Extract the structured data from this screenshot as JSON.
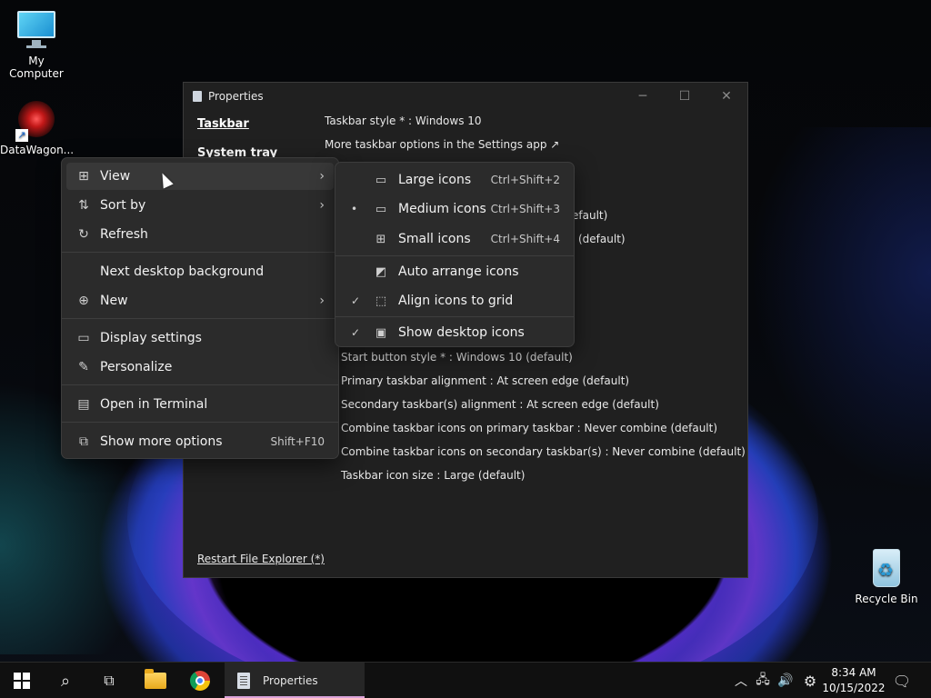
{
  "desktop": {
    "icons": [
      {
        "label": "My Computer",
        "icon": "computer-icon"
      },
      {
        "label": "DataWagon...",
        "icon": "app-shortcut-icon"
      },
      {
        "label": "Recycle Bin",
        "icon": "recycle-bin-icon"
      }
    ]
  },
  "window": {
    "title": "Properties",
    "nav": [
      "Taskbar",
      "System tray"
    ],
    "settings_top": [
      "Taskbar style * : Windows 10",
      "More taskbar options in the Settings app ↗"
    ],
    "partial_fragments": [
      "efault)",
      "(default)"
    ],
    "settings": [
      "Start button style * : Windows 10 (default)",
      "Primary taskbar alignment : At screen edge (default)",
      "Secondary taskbar(s) alignment : At screen edge (default)",
      "Combine taskbar icons on primary taskbar : Never combine (default)",
      "Combine taskbar icons on secondary taskbar(s) : Never combine (default)",
      "Taskbar icon size : Large (default)"
    ],
    "restart_link": "Restart File Explorer (*)"
  },
  "context_menu": {
    "items": [
      {
        "label": "View",
        "icon": "grid-icon",
        "submenu": true
      },
      {
        "label": "Sort by",
        "icon": "sort-icon",
        "submenu": true
      },
      {
        "label": "Refresh",
        "icon": "refresh-icon"
      },
      {
        "label": "Next desktop background",
        "icon": ""
      },
      {
        "label": "New",
        "icon": "plus-circle-icon",
        "submenu": true
      },
      {
        "label": "Display settings",
        "icon": "display-icon"
      },
      {
        "label": "Personalize",
        "icon": "brush-icon"
      },
      {
        "label": "Open in Terminal",
        "icon": "terminal-icon"
      },
      {
        "label": "Show more options",
        "icon": "expand-icon",
        "shortcut": "Shift+F10"
      }
    ]
  },
  "view_submenu": {
    "items": [
      {
        "label": "Large icons",
        "shortcut": "Ctrl+Shift+2",
        "mark": ""
      },
      {
        "label": "Medium icons",
        "shortcut": "Ctrl+Shift+3",
        "mark": "•"
      },
      {
        "label": "Small icons",
        "shortcut": "Ctrl+Shift+4",
        "mark": ""
      },
      {
        "label": "Auto arrange icons",
        "shortcut": "",
        "mark": ""
      },
      {
        "label": "Align icons to grid",
        "shortcut": "",
        "mark": "✓"
      },
      {
        "label": "Show desktop icons",
        "shortcut": "",
        "mark": "✓"
      }
    ]
  },
  "taskbar": {
    "active_app": "Properties",
    "time": "8:34 AM",
    "date": "10/15/2022"
  },
  "colors": {
    "accent_underline": "#d9a2d9",
    "menu_bg": "#2b2b2b",
    "window_bg": "#202020"
  }
}
